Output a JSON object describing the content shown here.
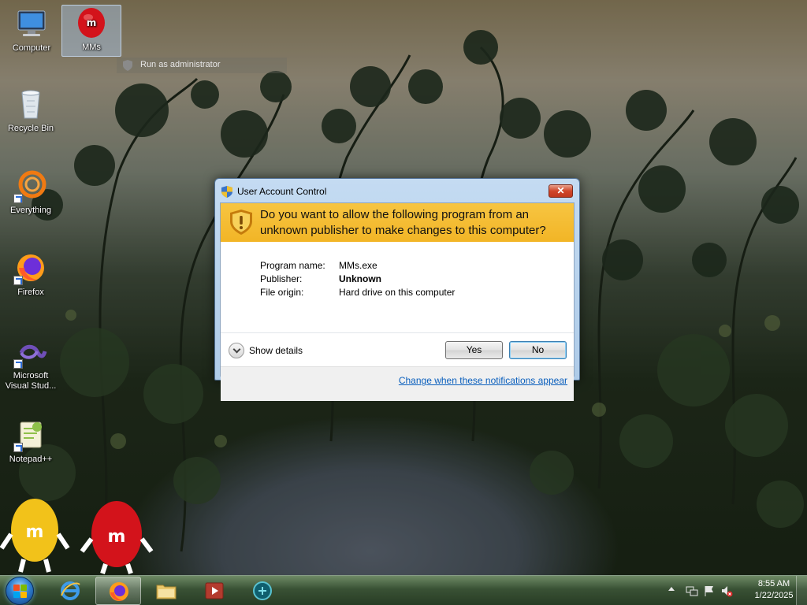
{
  "desktop": {
    "icons": [
      {
        "label": "Computer",
        "icon": "computer-icon"
      },
      {
        "label": "MMs",
        "icon": "mms-red-icon"
      },
      {
        "label": "Recycle Bin",
        "icon": "recycle-bin-icon"
      },
      {
        "label": "Everything",
        "icon": "everything-search-icon"
      },
      {
        "label": "Firefox",
        "icon": "firefox-icon"
      },
      {
        "label": "Microsoft Visual Stud...",
        "icon": "visual-studio-icon"
      },
      {
        "label": "Notepad++",
        "icon": "notepad-plus-plus-icon"
      }
    ],
    "context_hint": "Run as administrator"
  },
  "uac": {
    "title": "User Account Control",
    "close_label": "✕",
    "question": "Do you want to allow the following program from an unknown publisher to make changes to this computer?",
    "fields": [
      {
        "key": "Program name:",
        "value": "MMs.exe",
        "bold": false
      },
      {
        "key": "Publisher:",
        "value": "Unknown",
        "bold": true
      },
      {
        "key": "File origin:",
        "value": "Hard drive on this computer",
        "bold": false
      }
    ],
    "show_details": "Show details",
    "yes_label": "Yes",
    "no_label": "No",
    "footer_link": "Change when these notifications appear",
    "colors": {
      "banner": "#f2b526",
      "link": "#0a5fbd",
      "frame": "#aecbe8"
    }
  },
  "taskbar": {
    "items": [
      {
        "icon": "internet-explorer-icon",
        "active": false
      },
      {
        "icon": "firefox-icon",
        "active": true
      },
      {
        "icon": "file-explorer-icon",
        "active": false
      },
      {
        "icon": "media-player-icon",
        "active": false
      },
      {
        "icon": "app-icon",
        "active": false
      }
    ],
    "clock": {
      "time": "8:55 AM",
      "date": "1/22/2025"
    }
  }
}
